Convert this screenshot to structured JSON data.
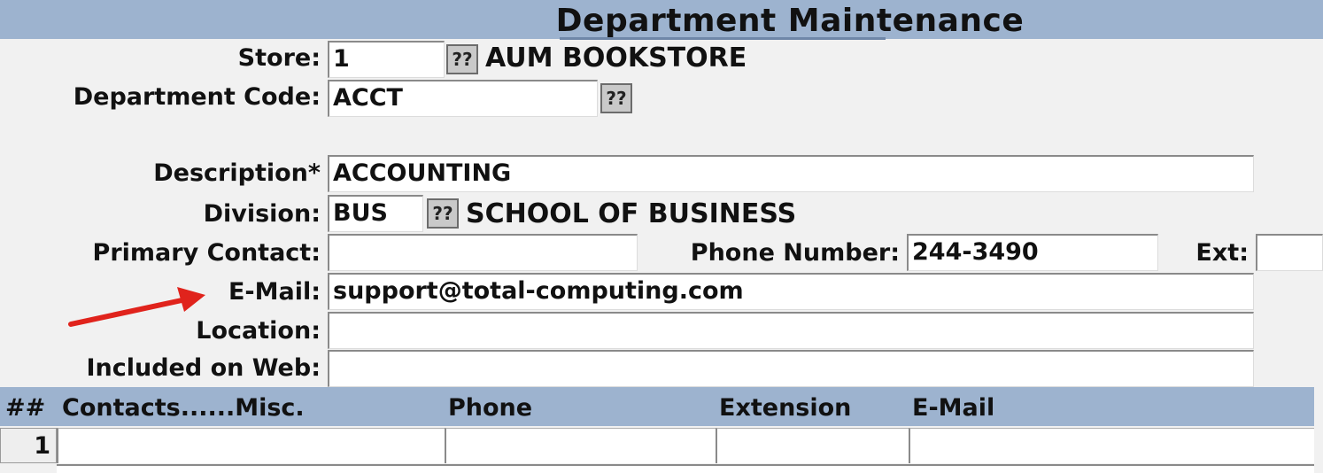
{
  "header": {
    "title": "Department Maintenance"
  },
  "form": {
    "store": {
      "label": "Store:",
      "value": "1",
      "lookup": "??",
      "description": "AUM BOOKSTORE"
    },
    "department_code": {
      "label": "Department Code:",
      "value": "ACCT",
      "lookup": "??"
    },
    "description": {
      "label": "Description*",
      "value": "ACCOUNTING"
    },
    "division": {
      "label": "Division:",
      "value": "BUS",
      "lookup": "??",
      "description": "SCHOOL OF BUSINESS"
    },
    "primary_contact": {
      "label": "Primary Contact:",
      "value": ""
    },
    "phone_number": {
      "label": "Phone Number:",
      "value": "244-3490"
    },
    "ext": {
      "label": "Ext:",
      "value": ""
    },
    "email": {
      "label": "E-Mail:",
      "value": "support@total-computing.com"
    },
    "location": {
      "label": "Location:",
      "value": ""
    },
    "included_on_web": {
      "label": "Included on Web:",
      "value": ""
    }
  },
  "grid": {
    "columns": [
      "##",
      "Contacts......Misc.",
      "Phone",
      "Extension",
      "E-Mail"
    ],
    "rows": [
      {
        "num": "1",
        "contact": "",
        "phone": "",
        "extension": "",
        "email": ""
      }
    ]
  },
  "annotation": {
    "arrow_color": "#e0231c"
  },
  "colors": {
    "header_bar": "#9db3cf",
    "background": "#f1f1f1"
  }
}
